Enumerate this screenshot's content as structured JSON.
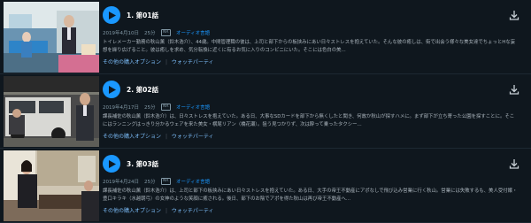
{
  "episodes": [
    {
      "title": "1. 第01話",
      "date": "2019年4月10日",
      "duration": "25分",
      "rating": "NR",
      "audio": "オーディオ言語",
      "description": "トイレメーカー勤務の秋山薫（鈴木浩介）、44歳。中間管理職の彼は、上司と部下からの板挟みにあい日々ストレスを抱えていた。そんな彼の癒しは、街で出会う様々な美女達でちょっとHな妄想を繰り広げること。彼は癒しを求め、気分転換に近くに有るお気に入りのコンビニにいた。そこには色白の美...",
      "link_options": "その他の購入オプション",
      "link_watch_party": "ウォッチパーティ"
    },
    {
      "title": "2. 第02話",
      "date": "2019年4月17日",
      "duration": "25分",
      "rating": "NR",
      "audio": "オーディオ言語",
      "description": "課長補佐の秋山薫（鈴木浩介）は、日々ストレスを抱えていた。ある日、大事なSDカードを部下から無くしたと聞き、何故か秋山が探すハメに。まず部下が立ち寄った公園を探すことに。そこにはランニングはっきり分かるウェアを来た美女・横尾リアン（橋花瀬）。狙う見つかりず、次は酔って乗ったタクシー...",
      "link_options": "その他の購入オプション",
      "link_watch_party": "ウォッチパーティ"
    },
    {
      "title": "3. 第03話",
      "date": "2019年4月24日",
      "duration": "25分",
      "rating": "NR",
      "audio": "オーディオ言語",
      "description": "課長補佐の秋山薫（鈴木浩介）は、上司と部下の板挟みにあい日々ストレスを抱えていた。ある日、大手の帝王不動産にアポなしで飛び込み営業に行く秋山。営業には失敗するも、美人受付嬢・豊口キラキ（水越朝弓）の女神のような笑顔に癒される。後日、部下のお陰でアポを得た秋山は再び帝王不動産へ...",
      "link_options": "その他の購入オプション",
      "link_watch_party": "ウォッチパーティ"
    }
  ],
  "separator": "|",
  "colors": {
    "background": "#0f171e",
    "accent": "#1a98ff",
    "link": "#79b8f3",
    "meta": "#8197a4"
  },
  "icons": {
    "play": "play-icon",
    "download": "download-icon"
  }
}
